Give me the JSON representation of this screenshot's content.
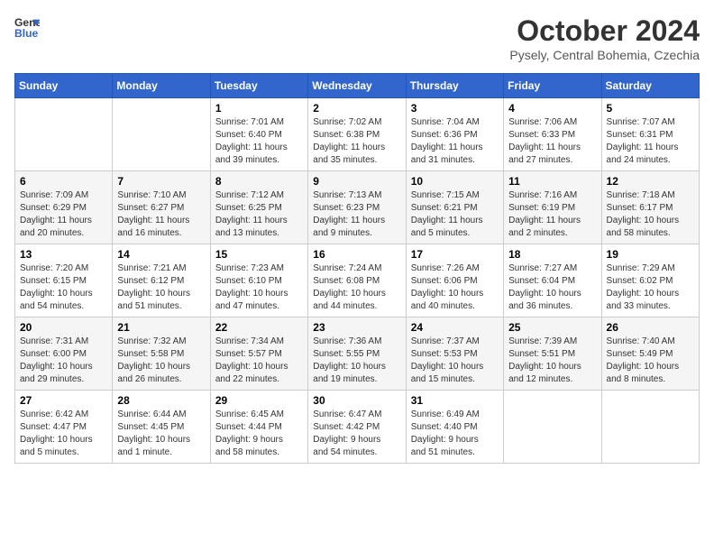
{
  "logo": {
    "line1": "General",
    "line2": "Blue"
  },
  "title": "October 2024",
  "subtitle": "Pysely, Central Bohemia, Czechia",
  "days_of_week": [
    "Sunday",
    "Monday",
    "Tuesday",
    "Wednesday",
    "Thursday",
    "Friday",
    "Saturday"
  ],
  "weeks": [
    [
      {
        "day": "",
        "info": ""
      },
      {
        "day": "",
        "info": ""
      },
      {
        "day": "1",
        "info": "Sunrise: 7:01 AM\nSunset: 6:40 PM\nDaylight: 11 hours\nand 39 minutes."
      },
      {
        "day": "2",
        "info": "Sunrise: 7:02 AM\nSunset: 6:38 PM\nDaylight: 11 hours\nand 35 minutes."
      },
      {
        "day": "3",
        "info": "Sunrise: 7:04 AM\nSunset: 6:36 PM\nDaylight: 11 hours\nand 31 minutes."
      },
      {
        "day": "4",
        "info": "Sunrise: 7:06 AM\nSunset: 6:33 PM\nDaylight: 11 hours\nand 27 minutes."
      },
      {
        "day": "5",
        "info": "Sunrise: 7:07 AM\nSunset: 6:31 PM\nDaylight: 11 hours\nand 24 minutes."
      }
    ],
    [
      {
        "day": "6",
        "info": "Sunrise: 7:09 AM\nSunset: 6:29 PM\nDaylight: 11 hours\nand 20 minutes."
      },
      {
        "day": "7",
        "info": "Sunrise: 7:10 AM\nSunset: 6:27 PM\nDaylight: 11 hours\nand 16 minutes."
      },
      {
        "day": "8",
        "info": "Sunrise: 7:12 AM\nSunset: 6:25 PM\nDaylight: 11 hours\nand 13 minutes."
      },
      {
        "day": "9",
        "info": "Sunrise: 7:13 AM\nSunset: 6:23 PM\nDaylight: 11 hours\nand 9 minutes."
      },
      {
        "day": "10",
        "info": "Sunrise: 7:15 AM\nSunset: 6:21 PM\nDaylight: 11 hours\nand 5 minutes."
      },
      {
        "day": "11",
        "info": "Sunrise: 7:16 AM\nSunset: 6:19 PM\nDaylight: 11 hours\nand 2 minutes."
      },
      {
        "day": "12",
        "info": "Sunrise: 7:18 AM\nSunset: 6:17 PM\nDaylight: 10 hours\nand 58 minutes."
      }
    ],
    [
      {
        "day": "13",
        "info": "Sunrise: 7:20 AM\nSunset: 6:15 PM\nDaylight: 10 hours\nand 54 minutes."
      },
      {
        "day": "14",
        "info": "Sunrise: 7:21 AM\nSunset: 6:12 PM\nDaylight: 10 hours\nand 51 minutes."
      },
      {
        "day": "15",
        "info": "Sunrise: 7:23 AM\nSunset: 6:10 PM\nDaylight: 10 hours\nand 47 minutes."
      },
      {
        "day": "16",
        "info": "Sunrise: 7:24 AM\nSunset: 6:08 PM\nDaylight: 10 hours\nand 44 minutes."
      },
      {
        "day": "17",
        "info": "Sunrise: 7:26 AM\nSunset: 6:06 PM\nDaylight: 10 hours\nand 40 minutes."
      },
      {
        "day": "18",
        "info": "Sunrise: 7:27 AM\nSunset: 6:04 PM\nDaylight: 10 hours\nand 36 minutes."
      },
      {
        "day": "19",
        "info": "Sunrise: 7:29 AM\nSunset: 6:02 PM\nDaylight: 10 hours\nand 33 minutes."
      }
    ],
    [
      {
        "day": "20",
        "info": "Sunrise: 7:31 AM\nSunset: 6:00 PM\nDaylight: 10 hours\nand 29 minutes."
      },
      {
        "day": "21",
        "info": "Sunrise: 7:32 AM\nSunset: 5:58 PM\nDaylight: 10 hours\nand 26 minutes."
      },
      {
        "day": "22",
        "info": "Sunrise: 7:34 AM\nSunset: 5:57 PM\nDaylight: 10 hours\nand 22 minutes."
      },
      {
        "day": "23",
        "info": "Sunrise: 7:36 AM\nSunset: 5:55 PM\nDaylight: 10 hours\nand 19 minutes."
      },
      {
        "day": "24",
        "info": "Sunrise: 7:37 AM\nSunset: 5:53 PM\nDaylight: 10 hours\nand 15 minutes."
      },
      {
        "day": "25",
        "info": "Sunrise: 7:39 AM\nSunset: 5:51 PM\nDaylight: 10 hours\nand 12 minutes."
      },
      {
        "day": "26",
        "info": "Sunrise: 7:40 AM\nSunset: 5:49 PM\nDaylight: 10 hours\nand 8 minutes."
      }
    ],
    [
      {
        "day": "27",
        "info": "Sunrise: 6:42 AM\nSunset: 4:47 PM\nDaylight: 10 hours\nand 5 minutes."
      },
      {
        "day": "28",
        "info": "Sunrise: 6:44 AM\nSunset: 4:45 PM\nDaylight: 10 hours\nand 1 minute."
      },
      {
        "day": "29",
        "info": "Sunrise: 6:45 AM\nSunset: 4:44 PM\nDaylight: 9 hours\nand 58 minutes."
      },
      {
        "day": "30",
        "info": "Sunrise: 6:47 AM\nSunset: 4:42 PM\nDaylight: 9 hours\nand 54 minutes."
      },
      {
        "day": "31",
        "info": "Sunrise: 6:49 AM\nSunset: 4:40 PM\nDaylight: 9 hours\nand 51 minutes."
      },
      {
        "day": "",
        "info": ""
      },
      {
        "day": "",
        "info": ""
      }
    ]
  ]
}
